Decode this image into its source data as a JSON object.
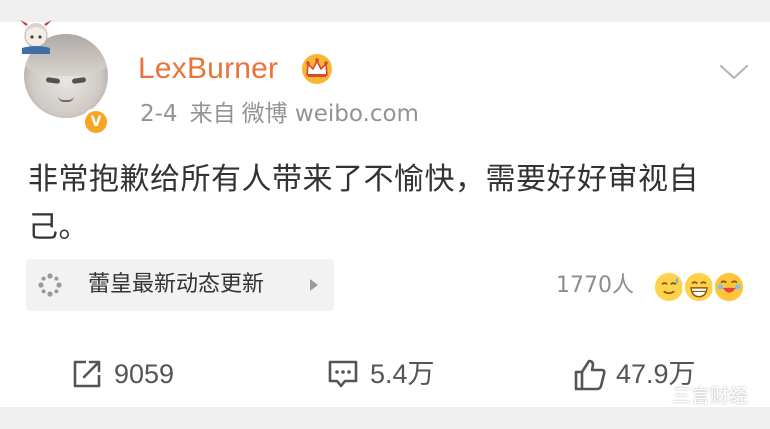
{
  "post": {
    "author": "LexBurner",
    "date": "2-4",
    "source_prefix": "来自",
    "source": "微博 weibo.com",
    "text": "非常抱歉给所有人带来了不愉快，需要好好审视自己。",
    "verified_badge": "V"
  },
  "topic": {
    "label": "蕾皇最新动态更新",
    "icon": "sparkle-icon"
  },
  "reactions": {
    "count_label": "1770人",
    "emojis": [
      "sweat-smile-emoji",
      "grin-emoji",
      "laugh-cry-emoji"
    ]
  },
  "actions": {
    "repost": {
      "icon": "repost-icon",
      "count": "9059"
    },
    "comment": {
      "icon": "comment-icon",
      "count": "5.4万"
    },
    "like": {
      "icon": "thumbs-up-icon",
      "count": "47.9万"
    }
  },
  "watermark": {
    "text": "三言财经",
    "icon": "wechat-icon"
  },
  "colors": {
    "username": "#e9733a",
    "meta": "#939393",
    "verified": "#f6a623",
    "card_bg": "#ffffff",
    "page_bg": "#efefef"
  }
}
